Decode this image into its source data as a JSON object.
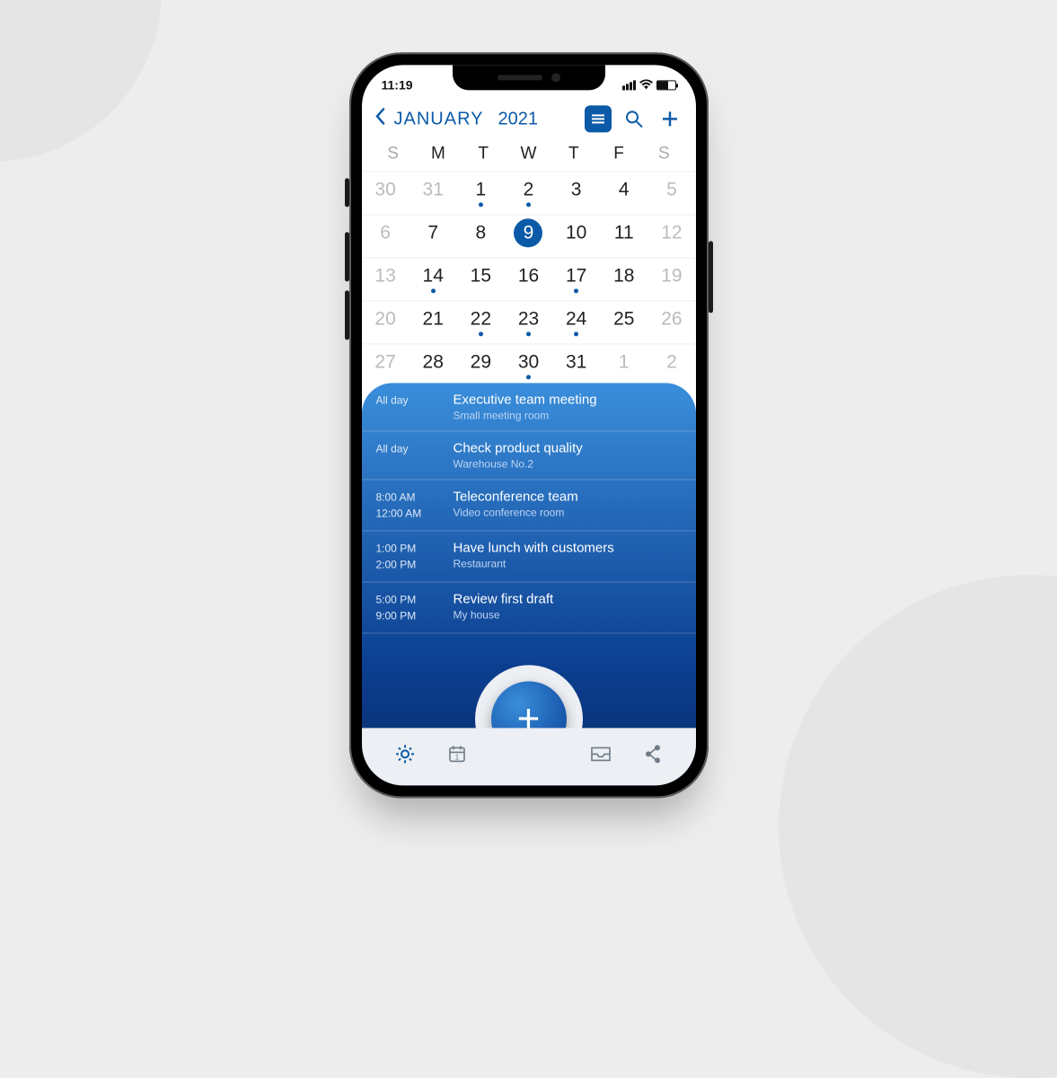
{
  "status": {
    "time": "11:19"
  },
  "header": {
    "month": "JANUARY",
    "year": "2021"
  },
  "weekdays": [
    "S",
    "M",
    "T",
    "W",
    "T",
    "F",
    "S"
  ],
  "calendar": [
    [
      {
        "n": "30",
        "dim": true
      },
      {
        "n": "31",
        "dim": true
      },
      {
        "n": "1",
        "dot": true
      },
      {
        "n": "2",
        "dot": true
      },
      {
        "n": "3"
      },
      {
        "n": "4"
      },
      {
        "n": "5",
        "dim": true
      }
    ],
    [
      {
        "n": "6",
        "dim": true
      },
      {
        "n": "7"
      },
      {
        "n": "8"
      },
      {
        "n": "9",
        "sel": true
      },
      {
        "n": "10"
      },
      {
        "n": "11"
      },
      {
        "n": "12",
        "dim": true
      }
    ],
    [
      {
        "n": "13",
        "dim": true
      },
      {
        "n": "14",
        "dot": true
      },
      {
        "n": "15"
      },
      {
        "n": "16"
      },
      {
        "n": "17",
        "dot": true
      },
      {
        "n": "18"
      },
      {
        "n": "19",
        "dim": true
      }
    ],
    [
      {
        "n": "20",
        "dim": true
      },
      {
        "n": "21"
      },
      {
        "n": "22",
        "dot": true
      },
      {
        "n": "23",
        "dot": true
      },
      {
        "n": "24",
        "dot": true
      },
      {
        "n": "25"
      },
      {
        "n": "26",
        "dim": true
      }
    ],
    [
      {
        "n": "27",
        "dim": true
      },
      {
        "n": "28"
      },
      {
        "n": "29"
      },
      {
        "n": "30",
        "dot": true
      },
      {
        "n": "31"
      },
      {
        "n": "1",
        "dim": true
      },
      {
        "n": "2",
        "dim": true
      }
    ]
  ],
  "events": [
    {
      "time1": "All day",
      "time2": "",
      "title": "Executive team meeting",
      "loc": "Small meeting room"
    },
    {
      "time1": "All day",
      "time2": "",
      "title": "Check product quality",
      "loc": "Warehouse  No.2"
    },
    {
      "time1": "8:00 AM",
      "time2": "12:00 AM",
      "title": "Teleconference team",
      "loc": "Video conference room"
    },
    {
      "time1": "1:00 PM",
      "time2": "2:00 PM",
      "title": "Have lunch with customers",
      "loc": "Restaurant"
    },
    {
      "time1": "5:00 PM",
      "time2": "9:00 PM",
      "title": "Review first draft",
      "loc": "My house"
    }
  ]
}
